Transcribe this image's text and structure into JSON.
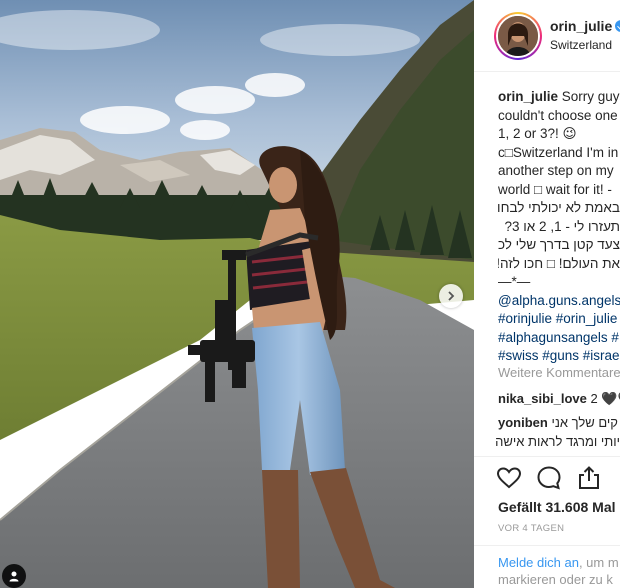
{
  "post": {
    "username": "orin_julie",
    "location": "Switzerland",
    "caption": {
      "line1_user": "orin_julie",
      "line1_text": " Sorry guys",
      "line2": "couldn't choose one",
      "line3": "1, 2 or 3?! 😉",
      "line4": "c□Switzerland I'm in",
      "line5": "another step on my",
      "line6": "world □ wait for it! -",
      "line7": "באמת לא יכולתי לבחור!",
      "line8": "תעזרו לי - 1, 2 או 3?",
      "line9": "צעד קטן בדרך שלי לכבוש",
      "line10": "את העולם! □ חכו לזה!",
      "line11": "—*—",
      "tag1": "@alpha.guns.angels",
      "tag2": "#orinjulie #orin_julie",
      "tag3": "#alphagunsangels #",
      "tag4": "#swiss #guns #israel"
    },
    "more_comments": "Weitere Kommentare",
    "comments": [
      {
        "user": "nika_sibi_love",
        "text": " 2 🖤🖤"
      },
      {
        "user": "yoniben",
        "text": " קים שלך אני"
      },
      {
        "user": "",
        "text": "יותי ומרגד לראות אישה"
      }
    ],
    "likes": "Gefällt 31.608 Mal",
    "time": "VOR 4 TAGEN",
    "login_link": "Melde dich an",
    "login_text": ", um m",
    "login_line2": "markieren oder zu k"
  },
  "icons": {
    "like": "heart-icon",
    "comment": "comment-icon",
    "share": "share-icon",
    "next": "chevron-right-icon",
    "tag": "user-tag-icon",
    "verified": "verified-badge-icon"
  },
  "colors": {
    "link": "#3897f0",
    "hashtag": "#003569",
    "muted": "#999999",
    "verified": "#3897f0"
  }
}
